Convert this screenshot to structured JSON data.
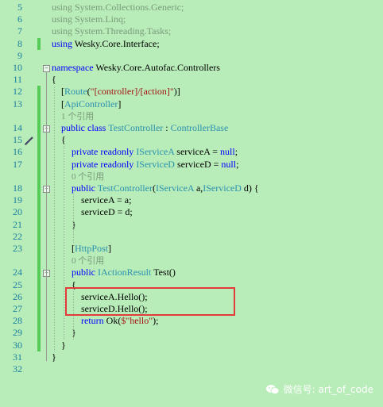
{
  "lines": [
    {
      "num": "5",
      "indent": 1,
      "html": "<span class='cm'>using System.Collections.Generic;</span>"
    },
    {
      "num": "6",
      "indent": 1,
      "html": "<span class='cm'>using System.Linq;</span>"
    },
    {
      "num": "7",
      "indent": 1,
      "html": "<span class='cm'>using System.Threading.Tasks;</span>"
    },
    {
      "num": "8",
      "indent": 1,
      "html": "<span class='kw'>using</span> Wesky.Core.Interface;"
    },
    {
      "num": "9",
      "indent": 1,
      "html": ""
    },
    {
      "num": "10",
      "indent": 1,
      "html": "<span class='kw'>namespace</span> Wesky.Core.Autofac.Controllers"
    },
    {
      "num": "11",
      "indent": 1,
      "html": "{"
    },
    {
      "num": "12",
      "indent": 2,
      "html": "[<span class='ty'>Route</span>(<span class='str'>\"[controller]/[action]\"</span>)]"
    },
    {
      "num": "13",
      "indent": 2,
      "html": "[<span class='ty'>ApiController</span>]"
    },
    {
      "num": "",
      "indent": 2,
      "html": "<span class='lens'>1 个引用</span>"
    },
    {
      "num": "14",
      "indent": 2,
      "html": "<span class='kw'>public class</span> <span class='ty'>TestController</span> : <span class='ty'>ControllerBase</span>"
    },
    {
      "num": "15",
      "indent": 2,
      "html": "{"
    },
    {
      "num": "16",
      "indent": 3,
      "html": "<span class='kw'>private readonly</span> <span class='ty'>IServiceA</span> serviceA = <span class='kw'>null</span>;"
    },
    {
      "num": "17",
      "indent": 3,
      "html": "<span class='kw'>private readonly</span> <span class='ty'>IServiceD</span> serviceD = <span class='kw'>null</span>;"
    },
    {
      "num": "",
      "indent": 3,
      "html": "<span class='lens'>0 个引用</span>"
    },
    {
      "num": "18",
      "indent": 3,
      "html": "<span class='kw'>public</span> <span class='ty'>TestController</span>(<span class='ty'>IServiceA</span> a,<span class='ty'>IServiceD</span> d) {"
    },
    {
      "num": "19",
      "indent": 4,
      "html": "serviceA = a;"
    },
    {
      "num": "20",
      "indent": 4,
      "html": "serviceD = d;"
    },
    {
      "num": "21",
      "indent": 3,
      "html": "}"
    },
    {
      "num": "22",
      "indent": 3,
      "html": ""
    },
    {
      "num": "23",
      "indent": 3,
      "html": "[<span class='ty'>HttpPost</span>]"
    },
    {
      "num": "",
      "indent": 3,
      "html": "<span class='lens'>0 个引用</span>"
    },
    {
      "num": "24",
      "indent": 3,
      "html": "<span class='kw'>public</span> <span class='ty'>IActionResult</span> Test()"
    },
    {
      "num": "25",
      "indent": 3,
      "html": "{"
    },
    {
      "num": "26",
      "indent": 4,
      "html": "serviceA.Hello();"
    },
    {
      "num": "27",
      "indent": 4,
      "html": "serviceD.Hello();"
    },
    {
      "num": "28",
      "indent": 4,
      "html": "<span class='kw'>return</span> Ok(<span class='str'>$\"hello\"</span>);"
    },
    {
      "num": "29",
      "indent": 3,
      "html": "}"
    },
    {
      "num": "30",
      "indent": 2,
      "html": "}"
    },
    {
      "num": "31",
      "indent": 1,
      "html": "}"
    },
    {
      "num": "32",
      "indent": 1,
      "html": ""
    }
  ],
  "changed_lines": [
    "8",
    "12",
    "13",
    "14",
    "15",
    "16",
    "17",
    "18",
    "19",
    "20",
    "21",
    "22",
    "23",
    "24",
    "25",
    "26",
    "27",
    "28",
    "29",
    "30"
  ],
  "fold_lines": [
    "10",
    "14",
    "18",
    "24"
  ],
  "watermark": {
    "text": "微信号: art_of_code"
  }
}
